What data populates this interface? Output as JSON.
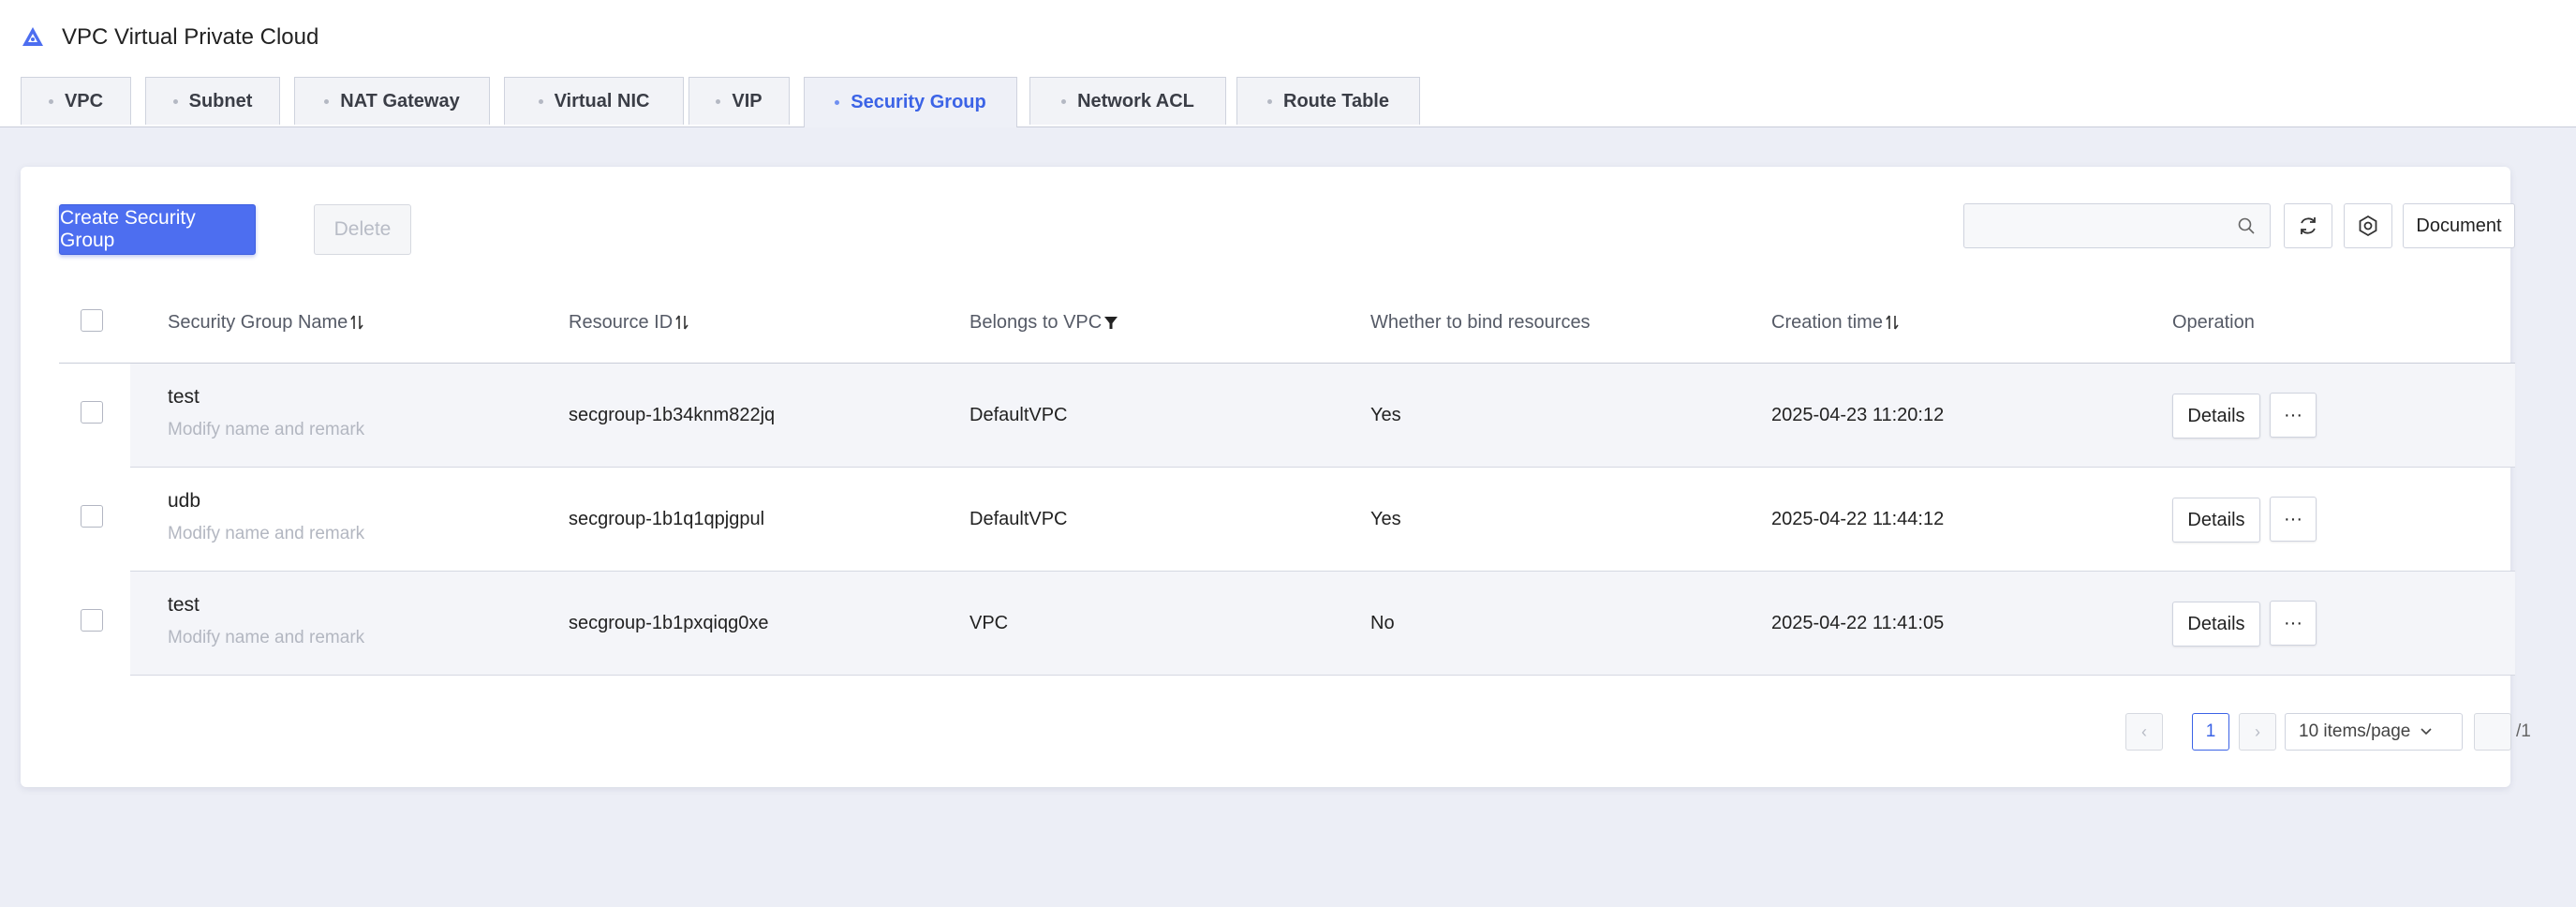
{
  "app": {
    "title": "VPC Virtual Private Cloud",
    "logo_icon": "vpc-logo-icon",
    "accent_color": "#3b63e6"
  },
  "tabs": [
    {
      "label": "VPC",
      "active": false
    },
    {
      "label": "Subnet",
      "active": false
    },
    {
      "label": "NAT Gateway",
      "active": false
    },
    {
      "label": "Virtual NIC",
      "active": false
    },
    {
      "label": "VIP",
      "active": false
    },
    {
      "label": "Security Group",
      "active": true
    },
    {
      "label": "Network ACL",
      "active": false
    },
    {
      "label": "Route Table",
      "active": false
    }
  ],
  "toolbar": {
    "create_label": "Create Security Group",
    "delete_label": "Delete",
    "search_value": "",
    "search_placeholder": "",
    "document_label": "Document"
  },
  "table": {
    "columns": [
      {
        "label": "Security Group Name",
        "icon": "sort-icon"
      },
      {
        "label": "Resource ID",
        "icon": "sort-icon"
      },
      {
        "label": "Belongs to VPC",
        "icon": "filter-icon"
      },
      {
        "label": "Whether to bind resources",
        "icon": ""
      },
      {
        "label": "Creation time",
        "icon": "sort-icon"
      },
      {
        "label": "Operation",
        "icon": ""
      }
    ],
    "rows": [
      {
        "name": "test",
        "remark": "Modify name and remark",
        "resource_id": "secgroup-1b34knm822jq",
        "vpc": "DefaultVPC",
        "bind": "Yes",
        "created": "2025-04-23 11:20:12",
        "details": "Details",
        "more": "···"
      },
      {
        "name": "udb",
        "remark": "Modify name and remark",
        "resource_id": "secgroup-1b1q1qpjgpul",
        "vpc": "DefaultVPC",
        "bind": "Yes",
        "created": "2025-04-22 11:44:12",
        "details": "Details",
        "more": "···"
      },
      {
        "name": "test",
        "remark": "Modify name and remark",
        "resource_id": "secgroup-1b1pxqiqg0xe",
        "vpc": "VPC",
        "bind": "No",
        "created": "2025-04-22 11:41:05",
        "details": "Details",
        "more": "···"
      }
    ]
  },
  "pagination": {
    "prev": "‹",
    "next": "›",
    "current_page": "1",
    "page_size": "10 items/page",
    "jump_value": "",
    "total_pages": "/1"
  }
}
